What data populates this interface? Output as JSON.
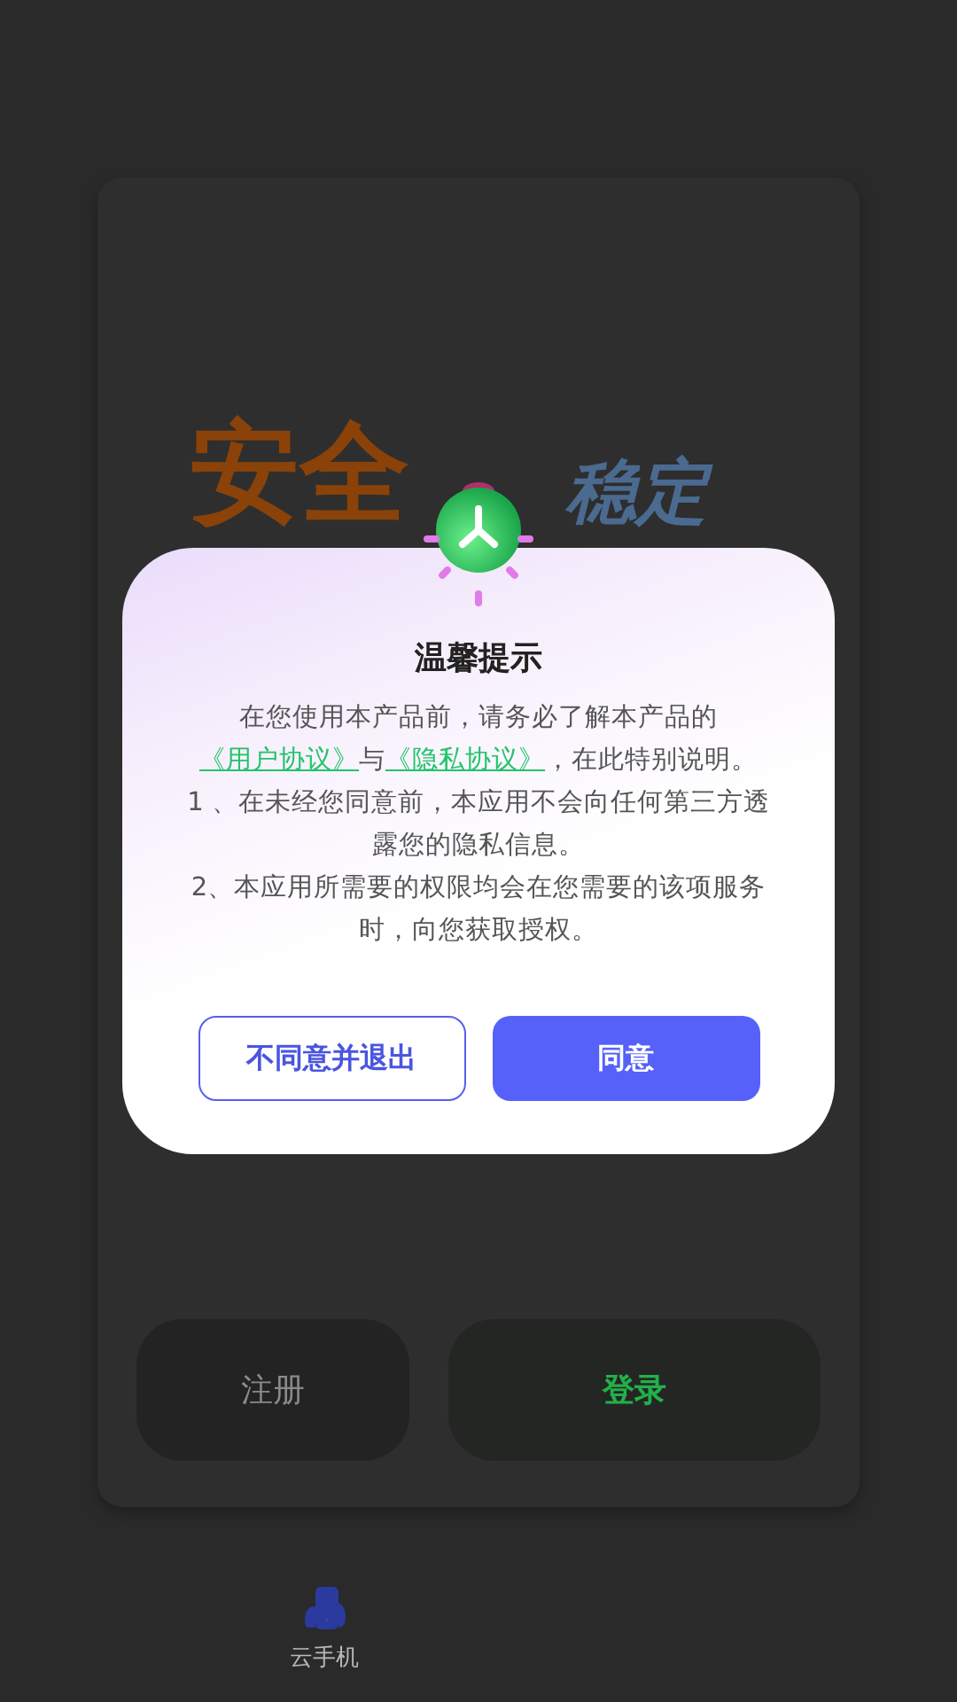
{
  "page": {
    "hero_words": [
      {
        "text": "安全",
        "color": "#8a4208"
      },
      {
        "text": "稳定",
        "color": "#4a6a90"
      }
    ],
    "buttons": [
      {
        "label": "注册",
        "kind": "secondary"
      },
      {
        "label": "登录",
        "kind": "primary"
      }
    ]
  },
  "tab_bar": {
    "items": [
      {
        "label": "云手机",
        "selected": true
      }
    ]
  },
  "dialog": {
    "title": "温馨提示",
    "paragraphs": [
      [
        {
          "kind": "text",
          "text": "在您使用本产品前，请务必了解本产品的"
        },
        {
          "kind": "link",
          "text": "《用户协议》"
        },
        {
          "kind": "text",
          "text": "与"
        },
        {
          "kind": "link",
          "text": "《隐私协议》"
        },
        {
          "kind": "text",
          "text": "，在此特别说明。"
        }
      ],
      [
        {
          "kind": "text",
          "text": "1 、在未经您同意前，本应用不会向任何第三方透露您的隐私信息。"
        }
      ],
      [
        {
          "kind": "text",
          "text": "2、本应用所需要的权限均会在您需要的该项服务时，向您获取授权。"
        }
      ]
    ],
    "buttons": [
      {
        "label": "不同意并退出",
        "kind": "secondary"
      },
      {
        "label": "同意",
        "kind": "primary"
      }
    ]
  }
}
